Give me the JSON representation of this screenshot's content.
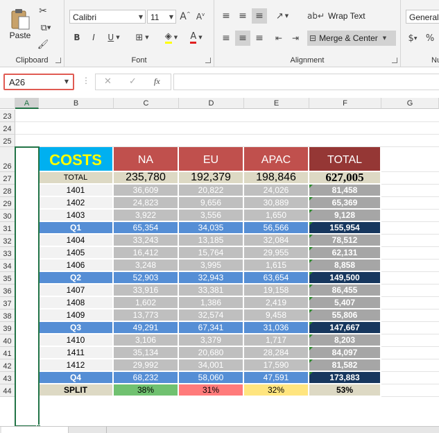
{
  "ribbon": {
    "clipboard": {
      "paste": "Paste",
      "label": "Clipboard"
    },
    "font": {
      "name": "Calibri",
      "size": "11",
      "label": "Font"
    },
    "alignment": {
      "wrap": "Wrap Text",
      "merge": "Merge & Center",
      "label": "Alignment"
    },
    "number": {
      "format": "General",
      "label": "Nu",
      "percent": "%"
    }
  },
  "formula_bar": {
    "name_box": "A26",
    "fx": "fx",
    "cancel": "✕",
    "enter": "✓",
    "value": ""
  },
  "columns": [
    "A",
    "B",
    "C",
    "D",
    "E",
    "F",
    "G"
  ],
  "rows": [
    "23",
    "24",
    "25",
    "26",
    "27",
    "28",
    "29",
    "30",
    "31",
    "32",
    "33",
    "34",
    "35",
    "36",
    "37",
    "38",
    "39",
    "40",
    "41",
    "42",
    "43",
    "44"
  ],
  "colors": {
    "header_na": "#c0504d",
    "header_total": "#953735",
    "quarter": "#558ed5",
    "quarter_total": "#17375e",
    "data": "#bfbfbf",
    "data_total": "#a6a6a6",
    "totals_row": "#ddd9c4",
    "costs_bg": "#00b0f0",
    "costs_fg": "#ffff00",
    "split_na": "#70c170",
    "split_eu": "#ff7b7b",
    "split_apac": "#ffe57f",
    "selection": "#217346"
  },
  "table": {
    "header": {
      "title": "COSTS",
      "na": "NA",
      "eu": "EU",
      "apac": "APAC",
      "total": "TOTAL"
    },
    "body": [
      {
        "row": "27",
        "type": "totals",
        "label": "TOTAL",
        "na": "235,780",
        "eu": "192,379",
        "apac": "198,846",
        "total": "627,005"
      },
      {
        "row": "28",
        "type": "data",
        "label": "1401",
        "na": "36,609",
        "eu": "20,822",
        "apac": "24,026",
        "total": "81,458"
      },
      {
        "row": "29",
        "type": "data",
        "label": "1402",
        "na": "24,823",
        "eu": "9,656",
        "apac": "30,889",
        "total": "65,369"
      },
      {
        "row": "30",
        "type": "data",
        "label": "1403",
        "na": "3,922",
        "eu": "3,556",
        "apac": "1,650",
        "total": "9,128"
      },
      {
        "row": "31",
        "type": "quarter",
        "label": "Q1",
        "na": "65,354",
        "eu": "34,035",
        "apac": "56,566",
        "total": "155,954"
      },
      {
        "row": "32",
        "type": "data",
        "label": "1404",
        "na": "33,243",
        "eu": "13,185",
        "apac": "32,084",
        "total": "78,512"
      },
      {
        "row": "33",
        "type": "data",
        "label": "1405",
        "na": "16,412",
        "eu": "15,764",
        "apac": "29,955",
        "total": "62,131"
      },
      {
        "row": "34",
        "type": "data",
        "label": "1406",
        "na": "3,248",
        "eu": "3,995",
        "apac": "1,615",
        "total": "8,858"
      },
      {
        "row": "35",
        "type": "quarter",
        "label": "Q2",
        "na": "52,903",
        "eu": "32,943",
        "apac": "63,654",
        "total": "149,500"
      },
      {
        "row": "36",
        "type": "data",
        "label": "1407",
        "na": "33,916",
        "eu": "33,381",
        "apac": "19,158",
        "total": "86,455"
      },
      {
        "row": "37",
        "type": "data",
        "label": "1408",
        "na": "1,602",
        "eu": "1,386",
        "apac": "2,419",
        "total": "5,407"
      },
      {
        "row": "38",
        "type": "data",
        "label": "1409",
        "na": "13,773",
        "eu": "32,574",
        "apac": "9,458",
        "total": "55,806"
      },
      {
        "row": "39",
        "type": "quarter",
        "label": "Q3",
        "na": "49,291",
        "eu": "67,341",
        "apac": "31,036",
        "total": "147,667"
      },
      {
        "row": "40",
        "type": "data",
        "label": "1410",
        "na": "3,106",
        "eu": "3,379",
        "apac": "1,717",
        "total": "8,203"
      },
      {
        "row": "41",
        "type": "data",
        "label": "1411",
        "na": "35,134",
        "eu": "20,680",
        "apac": "28,284",
        "total": "84,097"
      },
      {
        "row": "42",
        "type": "data",
        "label": "1412",
        "na": "29,992",
        "eu": "34,001",
        "apac": "17,590",
        "total": "81,582"
      },
      {
        "row": "43",
        "type": "quarter",
        "label": "Q4",
        "na": "68,232",
        "eu": "58,060",
        "apac": "47,591",
        "total": "173,883"
      },
      {
        "row": "44",
        "type": "split",
        "label": "SPLIT",
        "na": "38%",
        "eu": "31%",
        "apac": "32%",
        "total": "53%"
      }
    ]
  }
}
